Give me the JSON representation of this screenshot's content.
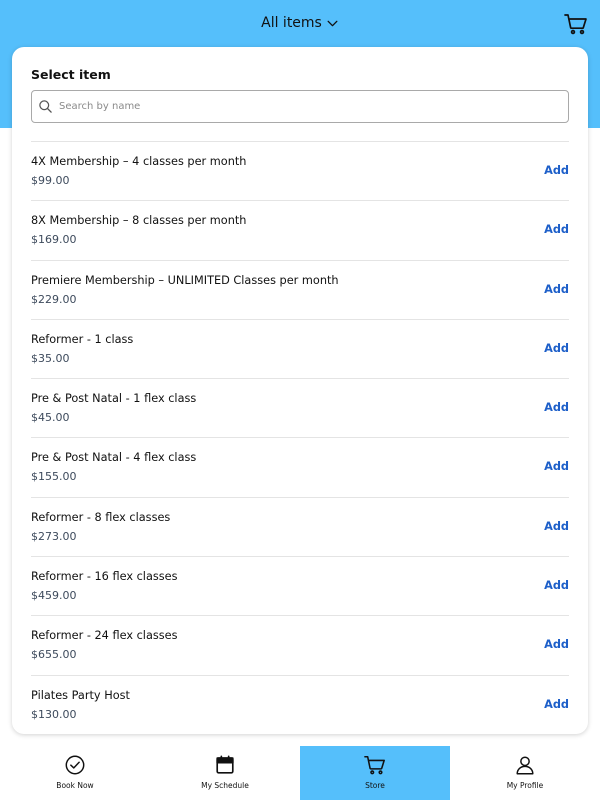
{
  "colors": {
    "accent": "#55bffb",
    "add_link": "#1d5fc9",
    "price": "#3d4a5c"
  },
  "header": {
    "title": "All items",
    "chevron_icon": "chevron-down-icon",
    "cart_icon": "cart-icon"
  },
  "panel": {
    "title": "Select item",
    "search": {
      "placeholder": "Search by name",
      "value": ""
    },
    "items": [
      {
        "name": "4X Membership – 4 classes per month",
        "price": "$99.00",
        "action": "Add"
      },
      {
        "name": "8X Membership – 8 classes per month",
        "price": "$169.00",
        "action": "Add"
      },
      {
        "name": "Premiere Membership – UNLIMITED Classes per month",
        "price": "$229.00",
        "action": "Add"
      },
      {
        "name": "Reformer - 1 class",
        "price": "$35.00",
        "action": "Add"
      },
      {
        "name": "Pre & Post Natal - 1 flex class",
        "price": "$45.00",
        "action": "Add"
      },
      {
        "name": "Pre & Post Natal - 4 flex class",
        "price": "$155.00",
        "action": "Add"
      },
      {
        "name": "Reformer - 8 flex classes",
        "price": "$273.00",
        "action": "Add"
      },
      {
        "name": "Reformer - 16 flex classes",
        "price": "$459.00",
        "action": "Add"
      },
      {
        "name": "Reformer - 24 flex classes",
        "price": "$655.00",
        "action": "Add"
      },
      {
        "name": "Pilates Party Host",
        "price": "$130.00",
        "action": "Add"
      }
    ]
  },
  "tabbar": {
    "tabs": [
      {
        "label": "Book Now",
        "icon": "check-circle-icon",
        "active": false
      },
      {
        "label": "My Schedule",
        "icon": "calendar-icon",
        "active": false
      },
      {
        "label": "Store",
        "icon": "cart-icon",
        "active": true
      },
      {
        "label": "My Profile",
        "icon": "user-icon",
        "active": false
      }
    ]
  }
}
